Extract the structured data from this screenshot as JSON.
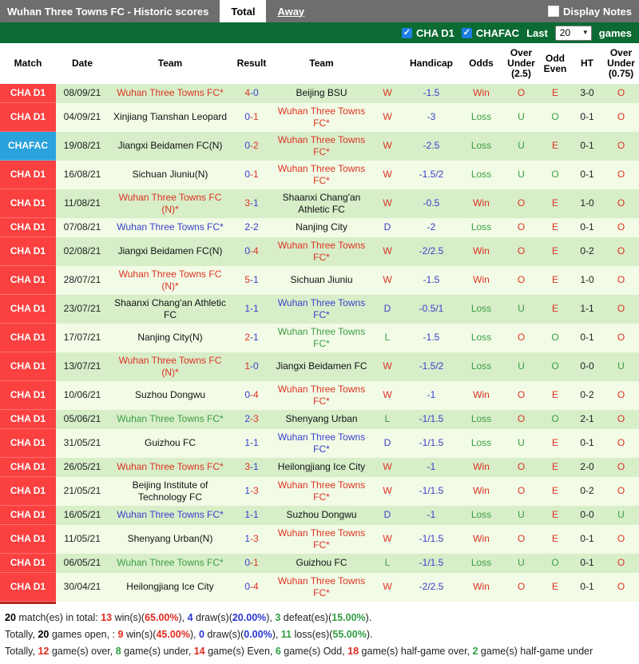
{
  "topbar": {
    "title": "Wuhan Three Towns FC - Historic scores",
    "tabs": [
      {
        "label": "Total",
        "active": true
      },
      {
        "label": "Away",
        "active": false
      }
    ],
    "display_notes_label": "Display Notes",
    "display_notes_checked": false
  },
  "filterbar": {
    "checkboxes": [
      {
        "label": "CHA D1",
        "checked": true
      },
      {
        "label": "CHAFAC",
        "checked": true
      }
    ],
    "last_label": "Last",
    "games_count": "20",
    "games_label": "games"
  },
  "icons": {
    "check": "✓",
    "chevron_down": "▼"
  },
  "colors": {
    "topbar_gray": "#6e6e6e",
    "filterbar_green": "#0b6b33",
    "league_d1_red": "#fb4040",
    "league_fac_blue": "#2aa2dc",
    "win_red": "#dd3322",
    "draw_blue": "#3a41cc",
    "loss_green": "#3b9e43",
    "row_green": "#d7eec9",
    "row_cream": "#f2fbe6",
    "checkbox_blue": "#1e7ee4"
  },
  "table": {
    "headers": [
      "Match",
      "Date",
      "Team",
      "Result",
      "Team",
      "",
      "Handicap",
      "Odds",
      "Over Under (2.5)",
      "Odd Even",
      "HT",
      "Over Under (0.75)"
    ],
    "rows": [
      {
        "league": "CHA D1",
        "date": "08/09/21",
        "home": {
          "name": "Wuhan Three Towns FC*",
          "color": "red"
        },
        "score": {
          "h": 4,
          "a": 0
        },
        "away": {
          "name": "Beijing BSU",
          "color": "black"
        },
        "wdl": "W",
        "handicap": "-1.5",
        "odds": "Win",
        "ou25": "O",
        "oe": "E",
        "ht": "3-0",
        "ou075": "O"
      },
      {
        "league": "CHA D1",
        "date": "04/09/21",
        "home": {
          "name": "Xinjiang Tianshan Leopard",
          "color": "black"
        },
        "score": {
          "h": 0,
          "a": 1
        },
        "away": {
          "name": "Wuhan Three Towns FC*",
          "color": "red"
        },
        "wdl": "W",
        "handicap": "-3",
        "odds": "Loss",
        "ou25": "U",
        "oe": "O",
        "ht": "0-1",
        "ou075": "O"
      },
      {
        "league": "CHAFAC",
        "date": "19/08/21",
        "home": {
          "name": "Jiangxi Beidamen FC(N)",
          "color": "black"
        },
        "score": {
          "h": 0,
          "a": 2
        },
        "away": {
          "name": "Wuhan Three Towns FC*",
          "color": "red"
        },
        "wdl": "W",
        "handicap": "-2.5",
        "odds": "Loss",
        "ou25": "U",
        "oe": "E",
        "ht": "0-1",
        "ou075": "O"
      },
      {
        "league": "CHA D1",
        "date": "16/08/21",
        "home": {
          "name": "Sichuan Jiuniu(N)",
          "color": "black"
        },
        "score": {
          "h": 0,
          "a": 1
        },
        "away": {
          "name": "Wuhan Three Towns FC*",
          "color": "red"
        },
        "wdl": "W",
        "handicap": "-1.5/2",
        "odds": "Loss",
        "ou25": "U",
        "oe": "O",
        "ht": "0-1",
        "ou075": "O"
      },
      {
        "league": "CHA D1",
        "date": "11/08/21",
        "home": {
          "name": "Wuhan Three Towns FC (N)*",
          "color": "red"
        },
        "score": {
          "h": 3,
          "a": 1
        },
        "away": {
          "name": "Shaanxi Chang'an Athletic FC",
          "color": "black"
        },
        "wdl": "W",
        "handicap": "-0.5",
        "odds": "Win",
        "ou25": "O",
        "oe": "E",
        "ht": "1-0",
        "ou075": "O"
      },
      {
        "league": "CHA D1",
        "date": "07/08/21",
        "home": {
          "name": "Wuhan Three Towns FC*",
          "color": "blue"
        },
        "score": {
          "h": 2,
          "a": 2
        },
        "away": {
          "name": "Nanjing City",
          "color": "black"
        },
        "wdl": "D",
        "handicap": "-2",
        "odds": "Loss",
        "ou25": "O",
        "oe": "E",
        "ht": "0-1",
        "ou075": "O"
      },
      {
        "league": "CHA D1",
        "date": "02/08/21",
        "home": {
          "name": "Jiangxi Beidamen FC(N)",
          "color": "black"
        },
        "score": {
          "h": 0,
          "a": 4
        },
        "away": {
          "name": "Wuhan Three Towns FC*",
          "color": "red"
        },
        "wdl": "W",
        "handicap": "-2/2.5",
        "odds": "Win",
        "ou25": "O",
        "oe": "E",
        "ht": "0-2",
        "ou075": "O"
      },
      {
        "league": "CHA D1",
        "date": "28/07/21",
        "home": {
          "name": "Wuhan Three Towns FC (N)*",
          "color": "red"
        },
        "score": {
          "h": 5,
          "a": 1
        },
        "away": {
          "name": "Sichuan Jiuniu",
          "color": "black"
        },
        "wdl": "W",
        "handicap": "-1.5",
        "odds": "Win",
        "ou25": "O",
        "oe": "E",
        "ht": "1-0",
        "ou075": "O"
      },
      {
        "league": "CHA D1",
        "date": "23/07/21",
        "home": {
          "name": "Shaanxi Chang'an Athletic FC",
          "color": "black"
        },
        "score": {
          "h": 1,
          "a": 1
        },
        "away": {
          "name": "Wuhan Three Towns FC*",
          "color": "blue"
        },
        "wdl": "D",
        "handicap": "-0.5/1",
        "odds": "Loss",
        "ou25": "U",
        "oe": "E",
        "ht": "1-1",
        "ou075": "O"
      },
      {
        "league": "CHA D1",
        "date": "17/07/21",
        "home": {
          "name": "Nanjing City(N)",
          "color": "black"
        },
        "score": {
          "h": 2,
          "a": 1
        },
        "away": {
          "name": "Wuhan Three Towns FC*",
          "color": "green"
        },
        "wdl": "L",
        "handicap": "-1.5",
        "odds": "Loss",
        "ou25": "O",
        "oe": "O",
        "ht": "0-1",
        "ou075": "O"
      },
      {
        "league": "CHA D1",
        "date": "13/07/21",
        "home": {
          "name": "Wuhan Three Towns FC (N)*",
          "color": "red"
        },
        "score": {
          "h": 1,
          "a": 0
        },
        "away": {
          "name": "Jiangxi Beidamen FC",
          "color": "black"
        },
        "wdl": "W",
        "handicap": "-1.5/2",
        "odds": "Loss",
        "ou25": "U",
        "oe": "O",
        "ht": "0-0",
        "ou075": "U"
      },
      {
        "league": "CHA D1",
        "date": "10/06/21",
        "home": {
          "name": "Suzhou Dongwu",
          "color": "black"
        },
        "score": {
          "h": 0,
          "a": 4
        },
        "away": {
          "name": "Wuhan Three Towns FC*",
          "color": "red"
        },
        "wdl": "W",
        "handicap": "-1",
        "odds": "Win",
        "ou25": "O",
        "oe": "E",
        "ht": "0-2",
        "ou075": "O"
      },
      {
        "league": "CHA D1",
        "date": "05/06/21",
        "home": {
          "name": "Wuhan Three Towns FC*",
          "color": "green"
        },
        "score": {
          "h": 2,
          "a": 3
        },
        "away": {
          "name": "Shenyang Urban",
          "color": "black"
        },
        "wdl": "L",
        "handicap": "-1/1.5",
        "odds": "Loss",
        "ou25": "O",
        "oe": "O",
        "ht": "2-1",
        "ou075": "O"
      },
      {
        "league": "CHA D1",
        "date": "31/05/21",
        "home": {
          "name": "Guizhou FC",
          "color": "black"
        },
        "score": {
          "h": 1,
          "a": 1
        },
        "away": {
          "name": "Wuhan Three Towns FC*",
          "color": "blue"
        },
        "wdl": "D",
        "handicap": "-1/1.5",
        "odds": "Loss",
        "ou25": "U",
        "oe": "E",
        "ht": "0-1",
        "ou075": "O"
      },
      {
        "league": "CHA D1",
        "date": "26/05/21",
        "home": {
          "name": "Wuhan Three Towns FC*",
          "color": "red"
        },
        "score": {
          "h": 3,
          "a": 1
        },
        "away": {
          "name": "Heilongjiang Ice City",
          "color": "black"
        },
        "wdl": "W",
        "handicap": "-1",
        "odds": "Win",
        "ou25": "O",
        "oe": "E",
        "ht": "2-0",
        "ou075": "O"
      },
      {
        "league": "CHA D1",
        "date": "21/05/21",
        "home": {
          "name": "Beijing Institute of Technology FC",
          "color": "black"
        },
        "score": {
          "h": 1,
          "a": 3
        },
        "away": {
          "name": "Wuhan Three Towns FC*",
          "color": "red"
        },
        "wdl": "W",
        "handicap": "-1/1.5",
        "odds": "Win",
        "ou25": "O",
        "oe": "E",
        "ht": "0-2",
        "ou075": "O"
      },
      {
        "league": "CHA D1",
        "date": "16/05/21",
        "home": {
          "name": "Wuhan Three Towns FC*",
          "color": "blue"
        },
        "score": {
          "h": 1,
          "a": 1
        },
        "away": {
          "name": "Suzhou Dongwu",
          "color": "black"
        },
        "wdl": "D",
        "handicap": "-1",
        "odds": "Loss",
        "ou25": "U",
        "oe": "E",
        "ht": "0-0",
        "ou075": "U"
      },
      {
        "league": "CHA D1",
        "date": "11/05/21",
        "home": {
          "name": "Shenyang Urban(N)",
          "color": "black"
        },
        "score": {
          "h": 1,
          "a": 3
        },
        "away": {
          "name": "Wuhan Three Towns FC*",
          "color": "red"
        },
        "wdl": "W",
        "handicap": "-1/1.5",
        "odds": "Win",
        "ou25": "O",
        "oe": "E",
        "ht": "0-1",
        "ou075": "O"
      },
      {
        "league": "CHA D1",
        "date": "06/05/21",
        "home": {
          "name": "Wuhan Three Towns FC*",
          "color": "green"
        },
        "score": {
          "h": 0,
          "a": 1
        },
        "away": {
          "name": "Guizhou FC",
          "color": "black"
        },
        "wdl": "L",
        "handicap": "-1/1.5",
        "odds": "Loss",
        "ou25": "U",
        "oe": "O",
        "ht": "0-1",
        "ou075": "O"
      },
      {
        "league": "CHA D1",
        "date": "30/04/21",
        "home": {
          "name": "Heilongjiang Ice City",
          "color": "black"
        },
        "score": {
          "h": 0,
          "a": 4
        },
        "away": {
          "name": "Wuhan Three Towns FC*",
          "color": "red"
        },
        "wdl": "W",
        "handicap": "-2/2.5",
        "odds": "Win",
        "ou25": "O",
        "oe": "E",
        "ht": "0-1",
        "ou075": "O"
      }
    ]
  },
  "summary": {
    "lines": [
      [
        {
          "t": "20",
          "c": "k"
        },
        {
          "t": " match(es) in total: ",
          "c": ""
        },
        {
          "t": "13",
          "c": "r"
        },
        {
          "t": " win(s)(",
          "c": ""
        },
        {
          "t": "65.00%",
          "c": "r"
        },
        {
          "t": "), ",
          "c": ""
        },
        {
          "t": "4",
          "c": "b"
        },
        {
          "t": " draw(s)(",
          "c": ""
        },
        {
          "t": "20.00%",
          "c": "b"
        },
        {
          "t": "), ",
          "c": ""
        },
        {
          "t": "3",
          "c": "g"
        },
        {
          "t": " defeat(es)(",
          "c": ""
        },
        {
          "t": "15.00%",
          "c": "g"
        },
        {
          "t": ").",
          "c": ""
        }
      ],
      [
        {
          "t": "Totally, ",
          "c": ""
        },
        {
          "t": "20",
          "c": "k"
        },
        {
          "t": " games open, : ",
          "c": ""
        },
        {
          "t": "9",
          "c": "r"
        },
        {
          "t": " win(s)(",
          "c": ""
        },
        {
          "t": "45.00%",
          "c": "r"
        },
        {
          "t": "), ",
          "c": ""
        },
        {
          "t": "0",
          "c": "b"
        },
        {
          "t": " draw(s)(",
          "c": ""
        },
        {
          "t": "0.00%",
          "c": "b"
        },
        {
          "t": "), ",
          "c": ""
        },
        {
          "t": "11",
          "c": "g"
        },
        {
          "t": " loss(es)(",
          "c": ""
        },
        {
          "t": "55.00%",
          "c": "g"
        },
        {
          "t": ").",
          "c": ""
        }
      ],
      [
        {
          "t": "Totally, ",
          "c": ""
        },
        {
          "t": "12",
          "c": "r"
        },
        {
          "t": " game(s) over, ",
          "c": ""
        },
        {
          "t": "8",
          "c": "g"
        },
        {
          "t": " game(s) under, ",
          "c": ""
        },
        {
          "t": "14",
          "c": "r"
        },
        {
          "t": " game(s) Even, ",
          "c": ""
        },
        {
          "t": "6",
          "c": "g"
        },
        {
          "t": " game(s) Odd, ",
          "c": ""
        },
        {
          "t": "18",
          "c": "r"
        },
        {
          "t": " game(s) half-game over, ",
          "c": ""
        },
        {
          "t": "2",
          "c": "g"
        },
        {
          "t": " game(s) half-game under",
          "c": ""
        }
      ]
    ]
  }
}
